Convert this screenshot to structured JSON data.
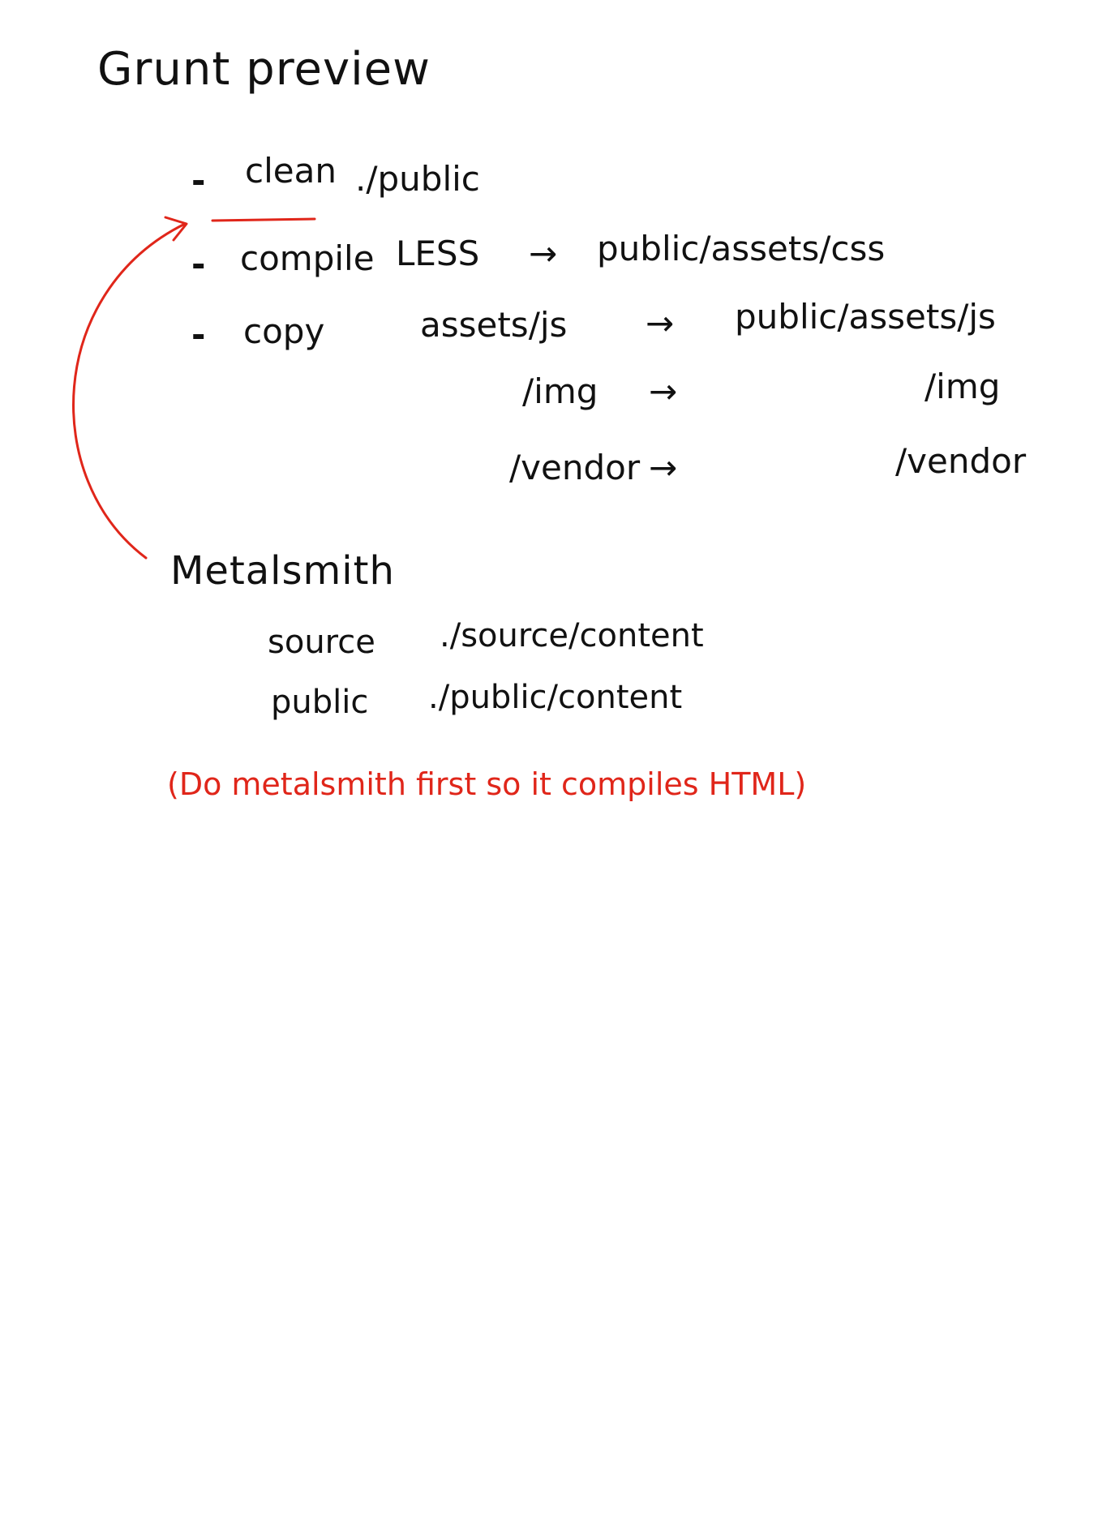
{
  "title": "Grunt preview",
  "tasks": [
    {
      "label": "clean",
      "source": "./public"
    },
    {
      "label": "compile",
      "source": "LESS",
      "target": "public/assets/css"
    },
    {
      "label": "copy",
      "source": "assets/js",
      "target": "public/assets/js"
    }
  ],
  "copy_subitems": [
    {
      "source": "/img",
      "target": "/img"
    },
    {
      "source": "/vendor",
      "target": "/vendor"
    }
  ],
  "metalsmith": {
    "heading": "Metalsmith",
    "rows": [
      {
        "label": "source",
        "path": "./source/content"
      },
      {
        "label": "public",
        "path": "./public/content"
      }
    ]
  },
  "note": "(Do metalsmith first so it compiles HTML)",
  "symbols": {
    "dash": "-",
    "arrow": "→"
  },
  "colors": {
    "ink": "#111111",
    "red_ink": "#e0261a"
  }
}
